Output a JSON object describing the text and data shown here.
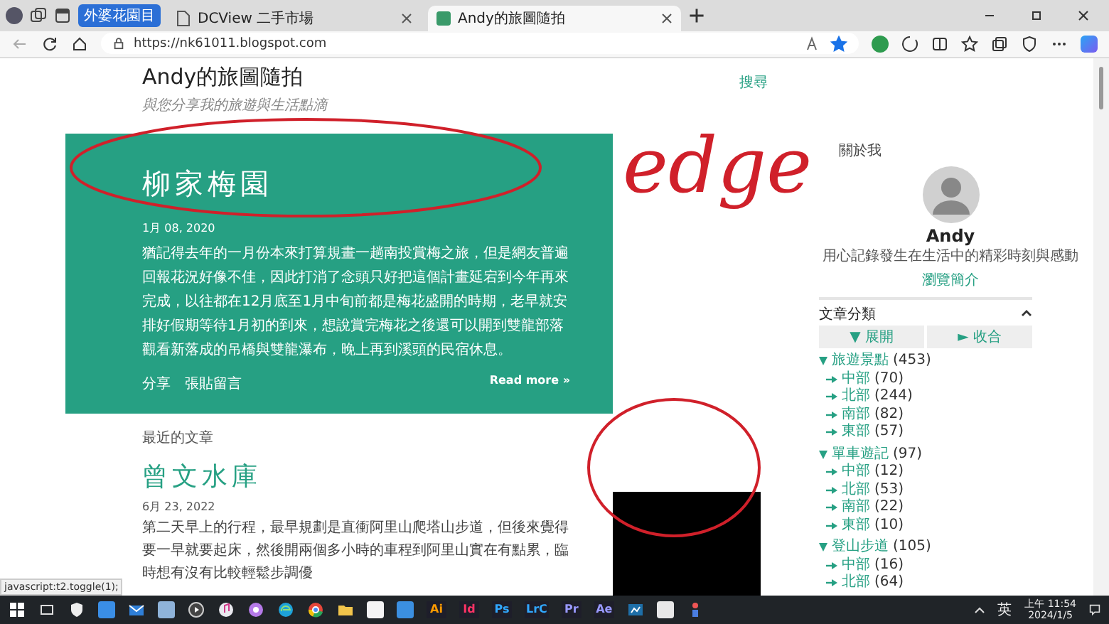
{
  "browser": {
    "tab_group": "外婆花園目",
    "tabs": [
      {
        "title": "DCView 二手市場",
        "selected": false
      },
      {
        "title": "Andy的旅圖隨拍",
        "selected": true
      }
    ],
    "url": "https://nk61011.blogspot.com",
    "favorite": true
  },
  "blog": {
    "title": "Andy的旅圖隨拍",
    "tagline": "與您分享我的旅遊與生活點滴",
    "search": "搜尋",
    "featured": {
      "title": "柳家梅園",
      "date": "1月 08, 2020",
      "excerpt": "猶記得去年的一月份本來打算規畫一趟南投賞梅之旅，但是網友普遍回報花況好像不佳，因此打消了念頭只好把這個計畫延宕到今年再來完成，以往都在12月底至1月中旬前都是梅花盛開的時期，老早就安排好假期等待1月初的到來，想說賞完梅花之後還可以開到雙龍部落觀看新落成的吊橋與雙龍瀑布，晚上再到溪頭的民宿休息。",
      "share": "分享",
      "comments": "張貼留言",
      "read_more": "Read more »"
    },
    "recent_heading": "最近的文章",
    "posts": [
      {
        "title": "曾文水庫",
        "date": "6月 23, 2022",
        "excerpt": "第二天早上的行程，最早規劃是直衝阿里山爬塔山步道，但後來覺得要一早就要起床，然後開兩個多小時的車程到阿里山實在有點累，臨時想有沒有比較輕鬆步調優"
      }
    ]
  },
  "sidebar": {
    "about_heading": "關於我",
    "name": "Andy",
    "bio": "用心記錄發生在生活中的精彩時刻與感動",
    "profile_link": "瀏覽簡介",
    "labels_heading": "文章分類",
    "expand_all": "▼ 展開",
    "collapse_all": "► 收合",
    "categories": [
      {
        "name": "旅遊景點",
        "count": "(453)",
        "expanded": true,
        "children": [
          {
            "name": "中部",
            "count": "(70)"
          },
          {
            "name": "北部",
            "count": "(244)"
          },
          {
            "name": "南部",
            "count": "(82)"
          },
          {
            "name": "東部",
            "count": "(57)"
          }
        ]
      },
      {
        "name": "單車遊記",
        "count": "(97)",
        "expanded": true,
        "children": [
          {
            "name": "中部",
            "count": "(12)"
          },
          {
            "name": "北部",
            "count": "(53)"
          },
          {
            "name": "南部",
            "count": "(22)"
          },
          {
            "name": "東部",
            "count": "(10)"
          }
        ]
      },
      {
        "name": "登山步道",
        "count": "(105)",
        "expanded": true,
        "children": [
          {
            "name": "中部",
            "count": "(16)"
          },
          {
            "name": "北部",
            "count": "(64)"
          }
        ]
      }
    ]
  },
  "status_url": "javascript:t2.toggle(1);",
  "taskbar": {
    "apps": [
      {
        "label": "Ai",
        "color": "#ff9a00"
      },
      {
        "label": "Id",
        "color": "#ff3366"
      },
      {
        "label": "Ps",
        "color": "#31a8ff"
      },
      {
        "label": "LrC",
        "color": "#31a8ff"
      },
      {
        "label": "Pr",
        "color": "#9999ff"
      },
      {
        "label": "Ae",
        "color": "#9999ff"
      }
    ],
    "ime": "英",
    "time": "上午 11:54",
    "date": "2024/1/5"
  },
  "annotation": {
    "handwriting": "edge"
  }
}
